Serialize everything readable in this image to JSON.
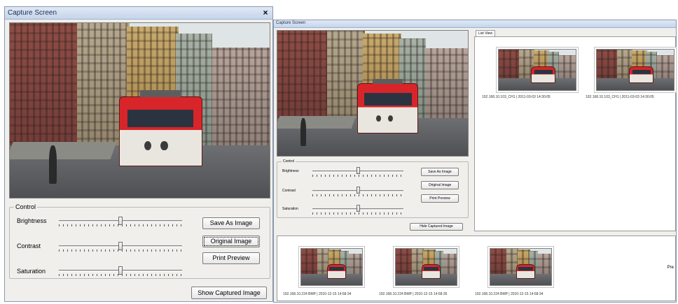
{
  "left_window": {
    "title": "Capture Screen",
    "close_glyph": "×",
    "control_group_label": "Control",
    "brightness_label": "Brightness",
    "contrast_label": "Contrast",
    "saturation_label": "Saturation",
    "brightness_level": 0.5,
    "contrast_level": 0.5,
    "saturation_level": 0.5,
    "save_button": "Save As Image",
    "original_button": "Original Image",
    "print_button": "Print Preview",
    "show_button": "Show Captured Image"
  },
  "right_window": {
    "title": "Capture Screen",
    "tab_label": "List View",
    "control_group_label": "Control",
    "brightness_label": "Brightness",
    "contrast_label": "Contrast",
    "saturation_label": "Saturation",
    "save_button": "Save As Image",
    "original_button": "Original Image",
    "print_button": "Print Preview",
    "hide_button": "Hide Captured Image",
    "list_items": [
      {
        "caption": "192.168.10.103_CH1 | 2011-03-03 14:30:05"
      },
      {
        "caption": "192.168.10.103_CH1 | 2011-03-03 14:30:05"
      }
    ],
    "strip_items": [
      {
        "caption": "192.168.10.224 BMP | 2010-12-15 14:58:34"
      },
      {
        "caption": "192.168.10.224 BMP | 2010-12-15 14:58:35"
      },
      {
        "caption": "192.168.10.224 BMP | 2010-12-15 14:58:34"
      }
    ],
    "strip_side_label": "Pre"
  }
}
